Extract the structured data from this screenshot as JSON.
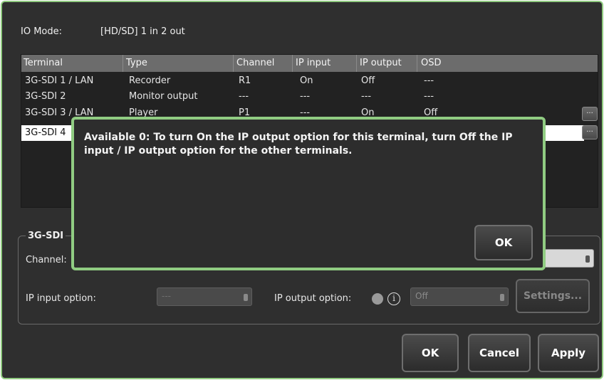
{
  "io_mode": {
    "label": "IO Mode:",
    "value": "[HD/SD] 1 in 2 out"
  },
  "table": {
    "headers": [
      "Terminal",
      "Type",
      "Channel",
      "IP input",
      "IP output",
      "OSD"
    ],
    "rows": [
      {
        "terminal": "3G-SDI 1 / LAN",
        "type": "Recorder",
        "channel": "R1",
        "ip_input": "On",
        "ip_output": "Off",
        "osd": "---"
      },
      {
        "terminal": "3G-SDI 2",
        "type": "Monitor output",
        "channel": "---",
        "ip_input": "---",
        "ip_output": "---",
        "osd": "---"
      },
      {
        "terminal": "3G-SDI 3 / LAN",
        "type": "Player",
        "channel": "P1",
        "ip_input": "---",
        "ip_output": "On",
        "osd": "Off"
      },
      {
        "terminal": "3G-SDI 4",
        "type": "",
        "channel": "",
        "ip_input": "",
        "ip_output": "",
        "osd": ""
      }
    ],
    "more_button_label": "..."
  },
  "settings_group": {
    "title": "3G-SDI",
    "channel_label": "Channel:",
    "ip_input_label": "IP input option:",
    "ip_input_value": "---",
    "ip_output_label": "IP output option:",
    "ip_output_value": "Off",
    "info_icon_glyph": "i",
    "settings_button": "Settings..."
  },
  "buttons": {
    "ok": "OK",
    "cancel": "Cancel",
    "apply": "Apply"
  },
  "dialog": {
    "message": "Available 0: To turn On the IP output option for this terminal, turn Off the IP input / IP output option for the other terminals.",
    "ok": "OK"
  },
  "colors": {
    "accent_border": "#90cc82",
    "background": "#2f2f2f",
    "header": "#6c6c6c"
  }
}
